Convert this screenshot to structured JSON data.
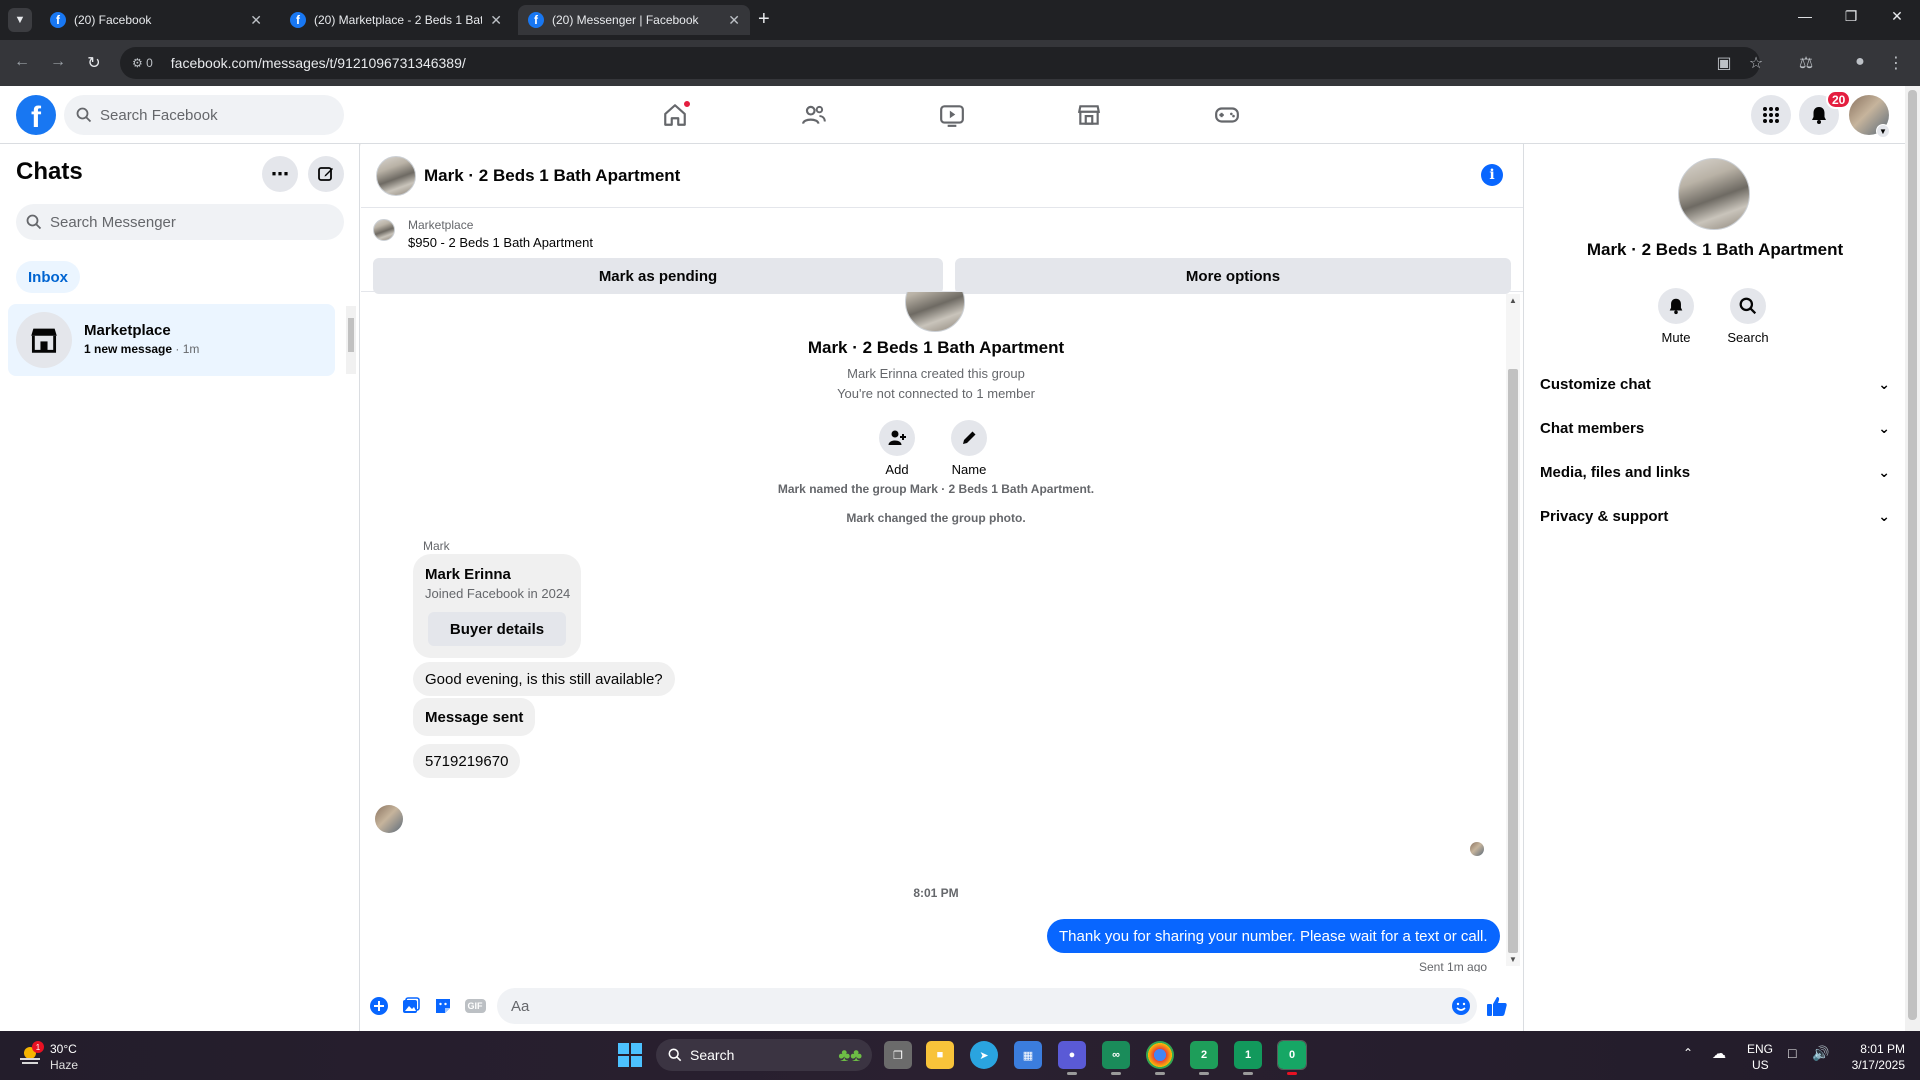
{
  "browser": {
    "tabs": [
      {
        "title": "(20) Facebook",
        "active": false
      },
      {
        "title": "(20) Marketplace - 2 Beds 1 Bat",
        "active": false
      },
      {
        "title": "(20) Messenger | Facebook",
        "active": true
      }
    ],
    "url": "facebook.com/messages/t/9121096731346389/",
    "site_info_count": "0"
  },
  "fb_header": {
    "logo_letter": "f",
    "search_placeholder": "Search Facebook",
    "notification_count": "20"
  },
  "sidebar": {
    "title": "Chats",
    "search_placeholder": "Search Messenger",
    "filter_active": "Inbox",
    "chats": [
      {
        "name": "Marketplace",
        "preview": "1 new message",
        "time": "· 1m"
      }
    ]
  },
  "conversation": {
    "title": "Mark · 2 Beds 1 Bath Apartment",
    "marketplace": {
      "label": "Marketplace",
      "listing": "$950 - 2 Beds 1 Bath Apartment",
      "btn_pending": "Mark as pending",
      "btn_more": "More options"
    },
    "group": {
      "title": "Mark · 2 Beds 1 Bath Apartment",
      "created": "Mark Erinna created this group",
      "not_connected": "You're not connected to 1 member",
      "add_label": "Add",
      "name_label": "Name"
    },
    "system_messages": [
      "Mark named the group Mark · 2 Beds 1 Bath Apartment.",
      "Mark changed the group photo."
    ],
    "sender_name": "Mark",
    "profile_card": {
      "name": "Mark Erinna",
      "joined": "Joined Facebook in 2024",
      "button": "Buyer details"
    },
    "incoming": [
      "Good evening, is this still available?",
      "Message sent",
      "5719219670"
    ],
    "time_separator": "8:01 PM",
    "outgoing": "Thank you for sharing your number. Please wait for a text or call.",
    "sent_status": "Sent 1m ago",
    "composer_placeholder": "Aa",
    "gif_label": "GIF"
  },
  "right_panel": {
    "title": "Mark · 2 Beds 1 Bath Apartment",
    "mute_label": "Mute",
    "search_label": "Search",
    "sections": [
      "Customize chat",
      "Chat members",
      "Media, files and links",
      "Privacy & support"
    ]
  },
  "taskbar": {
    "weather_temp": "30°C",
    "weather_desc": "Haze",
    "weather_badge": "1",
    "search_label": "Search",
    "app_badges": [
      "2",
      "1",
      "0"
    ],
    "lang_1": "ENG",
    "lang_2": "US",
    "time": "8:01 PM",
    "date": "3/17/2025"
  },
  "colors": {
    "fb_blue": "#1877f2",
    "messenger_blue": "#0866ff",
    "notification_red": "#e41e3f",
    "selected_chat_bg": "#ebf5ff"
  }
}
